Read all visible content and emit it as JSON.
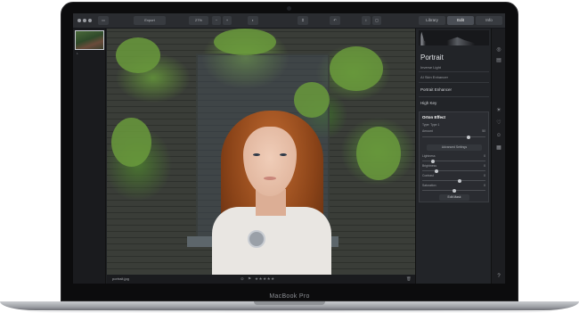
{
  "device": {
    "brand_label": "MacBook Pro"
  },
  "toolbar": {
    "window_controls": [
      "close",
      "minimize",
      "zoom"
    ],
    "buttons": [
      {
        "label": "Export"
      },
      {
        "label": "27%"
      }
    ],
    "mode_tabs": [
      {
        "label": "Library",
        "active": false
      },
      {
        "label": "Edit",
        "active": true
      },
      {
        "label": "Info",
        "active": false
      }
    ]
  },
  "filmstrip": {
    "count_label": "1"
  },
  "viewer": {
    "filename": "portrait.jpg",
    "rating_stars": "★★★★★"
  },
  "panel": {
    "title": "Portrait",
    "subtitle": "Inverse Light",
    "ai_label": "AI Skin Enhancer",
    "item_portrait_enhancer": "Portrait Enhancer",
    "item_high_key": "High Key",
    "section": {
      "title": "Orton Effect",
      "type_label": "Type: Type 1",
      "amount_label": "Amount",
      "amount_value": "50",
      "advanced_label": "Advanced Settings",
      "lightness_label": "Lightness",
      "lightness_value": "0",
      "brightness_label": "Brightness",
      "brightness_value": "0",
      "contrast_label": "Contrast",
      "contrast_value": "0",
      "saturation_label": "Saturation",
      "saturation_value": "0",
      "edit_mask_label": "Edit Mask"
    }
  },
  "colors": {
    "screen_bg": "#1d1f22",
    "panel_bg": "#222428",
    "accent_active_tab": "#4a4e55"
  }
}
